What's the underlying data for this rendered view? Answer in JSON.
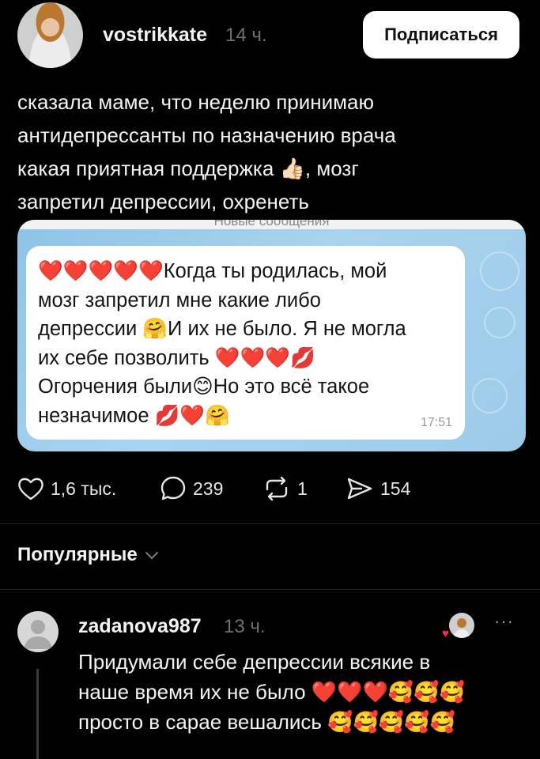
{
  "post": {
    "username": "vostrikkate",
    "time": "14 ч.",
    "subscribe_label": "Подписаться",
    "text_lines": [
      "сказала маме, что неделю принимаю",
      "антидепрессанты по назначению врача",
      "какая приятная поддержка 👍🏻, мозг",
      "запретил депрессии, охренеть"
    ]
  },
  "screenshot": {
    "top_partial_text": "Новые сообщения",
    "message_lines": [
      "❤️❤️❤️❤️❤️Когда ты родилась, мой",
      "мозг запретил мне какие либо",
      "депрессии 🤗И их не было. Я не могла",
      "их себе позволить ❤️❤️❤️💋",
      "Огорчения были😊Но это всё такое",
      "незначимое 💋❤️🤗"
    ],
    "message_time": "17:51"
  },
  "actions": {
    "likes": "1,6 тыс.",
    "comments": "239",
    "reposts": "1",
    "shares": "154"
  },
  "filter": {
    "label": "Популярные"
  },
  "comment": {
    "username": "zadanova987",
    "time": "13 ч.",
    "more": "···",
    "text_lines": [
      "Придумали себе депрессии всякие в",
      "наше время их не было ❤️❤️❤️🥰🥰🥰",
      "просто в сарае вешались 🥰🥰🥰🥰🥰"
    ]
  },
  "icons": [
    "heart-icon",
    "comment-icon",
    "repost-icon",
    "share-icon",
    "chevron-down-icon",
    "more-icon"
  ],
  "colors": {
    "background": "#000000",
    "text": "#f3f3f3",
    "muted": "#6f6f6f",
    "chat_bg": "#9ccbe9"
  }
}
